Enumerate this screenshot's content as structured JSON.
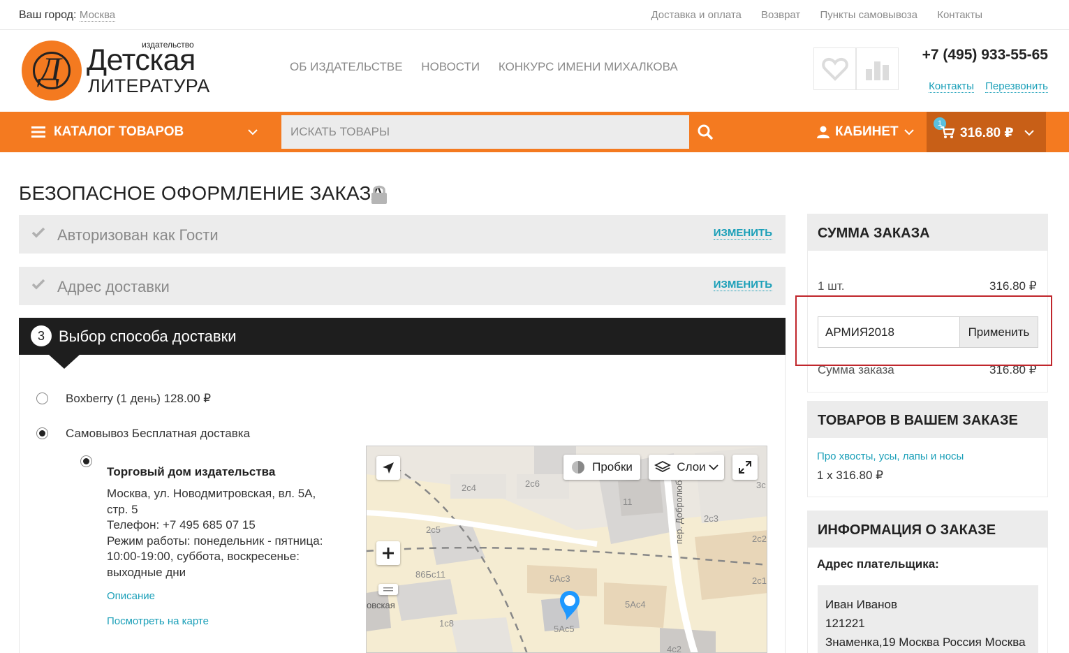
{
  "topbar": {
    "city_label": "Ваш город:",
    "city_value": "Москва",
    "links": [
      "Доставка и оплата",
      "Возврат",
      "Пункты самовывоза",
      "Контакты"
    ]
  },
  "header": {
    "logo_small": "издательство",
    "logo_big": "Детская",
    "logo_sub": "ЛИТЕРАТУРА",
    "nav": [
      "ОБ ИЗДАТЕЛЬСТВЕ",
      "НОВОСТИ",
      "КОНКУРС ИМЕНИ МИХАЛКОВА"
    ],
    "phone": "+7 (495) 933-55-65",
    "contacts_link": "Контакты",
    "callback_link": "Перезвонить"
  },
  "orangebar": {
    "catalog_label": "КАТАЛОГ ТОВАРОВ",
    "search_placeholder": "ИСКАТЬ ТОВАРЫ",
    "cabinet_label": "КАБИНЕТ",
    "cart_count": "1",
    "cart_amount": "316.80 ₽"
  },
  "page": {
    "title": "БЕЗОПАСНОЕ ОФОРМЛЕНИЕ ЗАКАЗА"
  },
  "steps": {
    "step1_label": "Авторизован как Гости",
    "step2_label": "Адрес доставки",
    "change_label": "ИЗМЕНИТЬ",
    "step3_number": "3",
    "step3_label": "Выбор способа доставки"
  },
  "delivery": {
    "option1": "Boxberry (1 день) 128.00 ₽",
    "option2": "Самовывоз Бесплатная доставка",
    "store_name": "Торговый дом издательства",
    "store_address": "Москва, ул. Новодмитровская, вл. 5А, стр. 5",
    "store_phone": "Телефон: +7 495 685 07 15",
    "store_hours": "Режим работы: понедельник - пятница: 10:00-19:00, суббота, воскресенье: выходные дни",
    "description_link": "Описание",
    "map_link": "Посмотреть на карте"
  },
  "map": {
    "traffic_label": "Пробки",
    "layers_label": "Слои",
    "labels": {
      "l1": "2с4",
      "l2": "2с6",
      "l3": "11",
      "l4": "2с3",
      "l5": "2с5",
      "l6": "5Ас3",
      "l7": "5Ас4",
      "l8": "5Ас5",
      "l9": "86Бс11",
      "l10": "1с8",
      "l11": "2с1",
      "l12": "2с2",
      "l13": "3с",
      "l14": "4с2",
      "l15": "пер. Добролюбова",
      "l16": "овская"
    }
  },
  "sidebar": {
    "sum_title": "СУММА ЗАКАЗА",
    "qty_label": "1 шт.",
    "qty_value": "316.80 ₽",
    "coupon_value": "АРМИЯ2018",
    "apply_label": "Применить",
    "total_label": "Сумма заказа",
    "total_value": "316.80 ₽",
    "items_title": "ТОВАРОВ В ВАШЕМ ЗАКАЗЕ",
    "item_name": "Про хвосты, усы, лапы и носы",
    "item_qty": "1 x 316.80 ₽",
    "info_title": "ИНФОРМАЦИЯ О ЗАКАЗЕ",
    "payer_label": "Адрес плательщика:",
    "payer_name": "Иван Иванов",
    "payer_zip": "121221",
    "payer_address": "Знаменка,19 Москва Россия Москва"
  },
  "colors": {
    "accent": "#f47a20",
    "accent_dark": "#c85f17",
    "link": "#1a9fb8",
    "dark_header": "#1e1e1e",
    "highlight_frame": "#c0262c"
  }
}
